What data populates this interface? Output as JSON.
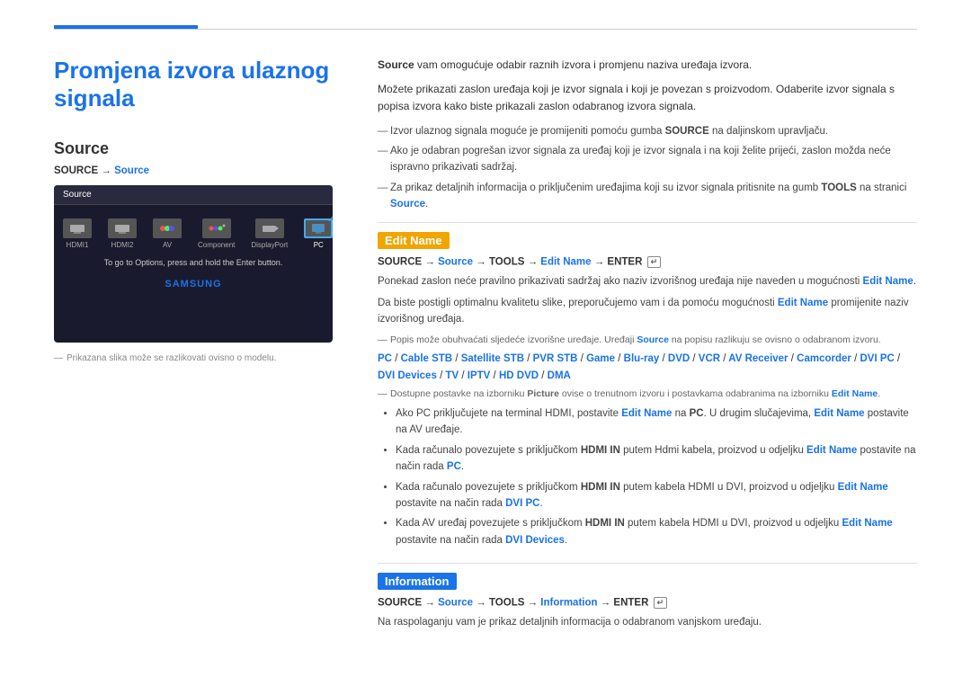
{
  "page": {
    "title": "Promjena izvora ulaznog signala",
    "top_line_color": "#1a73e8"
  },
  "left": {
    "section_title": "Source",
    "source_path_label": "SOURCE → ",
    "source_path_link": "Source",
    "tv_screen": {
      "header": "Source",
      "icons": [
        {
          "label": "HDMI1",
          "type": "hdmi"
        },
        {
          "label": "HDMI2",
          "type": "hdmi"
        },
        {
          "label": "AV",
          "type": "av"
        },
        {
          "label": "Component",
          "type": "component"
        },
        {
          "label": "DisplayPort",
          "type": "displayport"
        },
        {
          "label": "PC",
          "type": "pc",
          "selected": true
        }
      ],
      "message": "To go to Options, press and hold the Enter button.",
      "logo": "SAMSUNG"
    },
    "image_note": "Prikazana slika može se razlikovati ovisno o modelu."
  },
  "right": {
    "intro_bold": "Source",
    "intro1": " vam omogućuje odabir raznih izvora i promjenu naziva uređaja izvora.",
    "intro2": "Možete prikazati zaslon uređaja koji je izvor signala i koji je povezan s proizvodom. Odaberite izvor signala s popisa izvora kako biste prikazali zaslon odabranog izvora signala.",
    "bullets": [
      "Izvor ulaznog signala moguće je promijeniti pomoću gumba SOURCE na daljinskom upravljaču.",
      "Ako je odabran pogrešan izvor signala za uređaj koji je izvor signala i na koji želite prijeći, zaslon možda neće ispravno prikazivati sadržaj.",
      "Za prikaz detaljnih informacija o priključenim uređajima koji su izvor signala pritisnite na gumb TOOLS na stranici Source."
    ],
    "edit_name": {
      "title": "Edit Name",
      "cmd": "SOURCE → Source → TOOLS → Edit Name → ENTER",
      "body1": "Ponekad zaslon neće pravilno prikazivati sadržaj ako naziv izvorišnog uređaja nije naveden u mogućnosti Edit Name.",
      "body2": "Da biste postigli optimalnu kvalitetu slike, preporučujemo vam i da pomoću mogućnosti Edit Name promijenite naziv izvorišnog uređaja.",
      "note1": "Popis može obuhvaćati sljedeće izvorišne uređaje. Uređaji Source na popisu razlikuju se ovisno o odabranom izvoru.",
      "devices": "PC / Cable STB / Satellite STB / PVR STB / Game / Blu-ray / DVD / VCR / AV Receiver / Camcorder / DVI PC / DVI Devices / TV / IPTV / HD DVD / DMA",
      "note2": "Dostupne postavke na izborniku Picture ovise o trenutnom izvoru i postavkama odabranima na izborniku Edit Name.",
      "dot_items": [
        "Ako PC priključujete na terminal HDMI, postavite Edit Name na PC. U drugim slučajevima, Edit Name postavite na AV uređaje.",
        "Kada računalo povezujete s priključkom HDMI IN putem Hdmi kabela, proizvod u odjeljku Edit Name postavite na način rada PC.",
        "Kada računalo povezujete s priključkom HDMI IN putem kabela HDMI u DVI, proizvod u odjeljku Edit Name postavite na način rada DVI PC.",
        "Kada AV uređaj povezujete s priključkom HDMI IN putem kabela HDMI u DVI, proizvod u odjeljku Edit Name postavite na način rada DVI Devices."
      ]
    },
    "information": {
      "title": "Information",
      "cmd": "SOURCE → Source → TOOLS → Information → ENTER",
      "body": "Na raspolaganju vam je prikaz detaljnih informacija o odabranom vanjskom uređaju."
    }
  }
}
